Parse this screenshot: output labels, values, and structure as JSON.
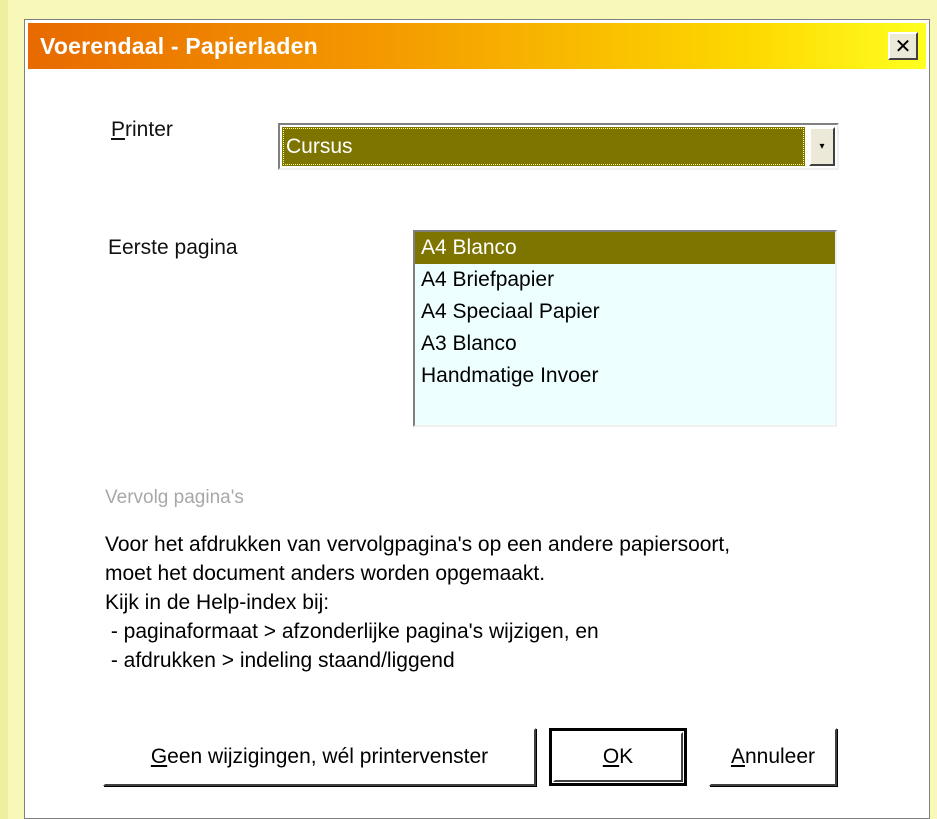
{
  "window": {
    "title": "Voerendaal - Papierladen",
    "close_glyph": "✕"
  },
  "printer": {
    "label_accel": "P",
    "label_rest": "rinter",
    "selected_value": "Cursus",
    "dropdown_glyph": "▾"
  },
  "first_page": {
    "label": "Eerste pagina",
    "options": [
      "A4 Blanco",
      "A4 Briefpapier",
      "A4 Speciaal Papier",
      "A3 Blanco",
      "Handmatige Invoer"
    ],
    "selected_index": 0
  },
  "followup": {
    "heading": "Vervolg pagina's",
    "lines": [
      "Voor het afdrukken van vervolgpagina's op een andere papiersoort,",
      "moet het document anders worden opgemaakt.",
      "Kijk in de Help-index bij:",
      " - paginaformaat > afzonderlijke pagina's wijzigen, en",
      " - afdrukken > indeling staand/liggend"
    ]
  },
  "buttons": {
    "printdialog_accel": "G",
    "printdialog_rest": "een wijzigingen, wél printervenster",
    "ok_accel": "O",
    "ok_rest": "K",
    "cancel_accel": "A",
    "cancel_rest": "nnuleer"
  },
  "colors": {
    "selection": "#7e7400",
    "titlebar_start": "#e86a00",
    "titlebar_end": "#ffff20",
    "listbox_bg": "#eeffff",
    "desktop_bg": "#f8f8b8"
  }
}
